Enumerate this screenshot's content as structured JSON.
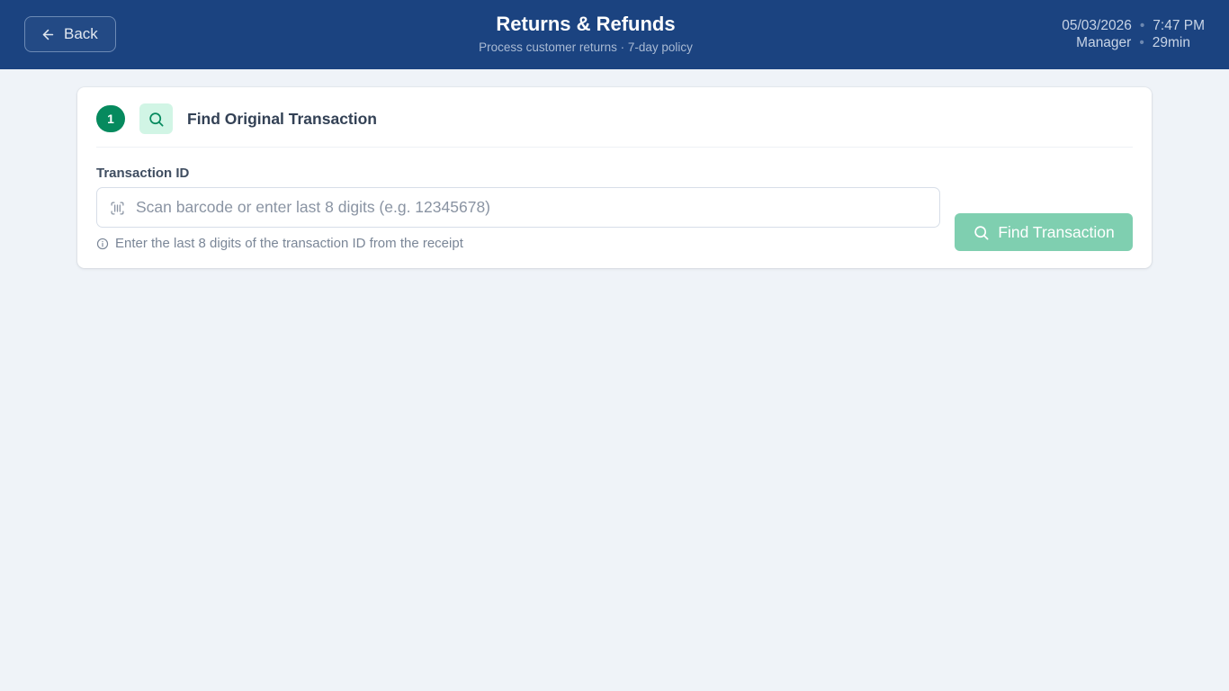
{
  "header": {
    "back_label": "Back",
    "title": "Returns & Refunds",
    "subtitle": "Process customer returns · 7-day policy",
    "date": "05/03/2026",
    "time": "7:47 PM",
    "role": "Manager",
    "session": "29min",
    "separator": "•"
  },
  "step": {
    "number": "1",
    "title": "Find Original Transaction",
    "icon": "search-icon"
  },
  "form": {
    "label": "Transaction ID",
    "value": "",
    "placeholder": "Scan barcode or enter last 8 digits (e.g. 12345678)",
    "input_icon": "barcode-scan-icon",
    "hint": "Enter the last 8 digits of the transaction ID from the receipt",
    "hint_icon": "info-icon",
    "submit_label": "Find Transaction",
    "submit_icon": "search-icon"
  },
  "colors": {
    "header_bg": "#1b4380",
    "page_bg": "#eff3f8",
    "accent": "#068a5e",
    "accent_light": "#d1f5e5",
    "button_disabled": "#7fcfb0"
  }
}
